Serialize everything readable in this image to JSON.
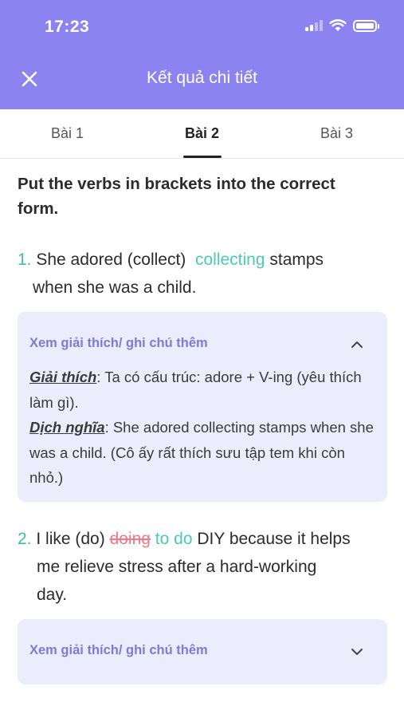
{
  "status_bar": {
    "time": "17:23"
  },
  "header": {
    "title": "Kết quả chi tiết",
    "close_icon": "close-icon"
  },
  "tabs": [
    {
      "label": "Bài 1",
      "active": false
    },
    {
      "label": "Bài 2",
      "active": true
    },
    {
      "label": "Bài 3",
      "active": false
    }
  ],
  "exercise": {
    "instruction": "Put the verbs in brackets into the correct form.",
    "questions": [
      {
        "number": "1.",
        "text_before": "She adored (collect)",
        "correct_answer": "collecting",
        "text_after": "stamps",
        "line2": "when she was a child.",
        "explanation": {
          "toggle_label": "Xem giải thích/ ghi chú thêm",
          "expanded": true,
          "explain_label": "Giải thích",
          "explain_text": ": Ta có cấu trúc: adore + V-ing (yêu thích làm gì).",
          "translate_label": "Dịch nghĩa",
          "translate_text": ": She adored collecting stamps when she was a child. (Cô ấy rất thích sưu tập tem khi còn nhỏ.)"
        }
      },
      {
        "number": "2.",
        "text_before": "I like (do)",
        "wrong_answer": "doing",
        "correct_answer": "to do",
        "text_after": "DIY because it helps",
        "line2": "me relieve stress after a hard-working",
        "line3": "day.",
        "explanation": {
          "toggle_label": "Xem giải thích/ ghi chú thêm",
          "expanded": false
        }
      }
    ]
  },
  "colors": {
    "header_bg": "#8b84f0",
    "correct": "#4ccab4",
    "wrong": "#f07a8a",
    "card_bg": "#ecedfc",
    "toggle_text": "#7e7bd8"
  }
}
